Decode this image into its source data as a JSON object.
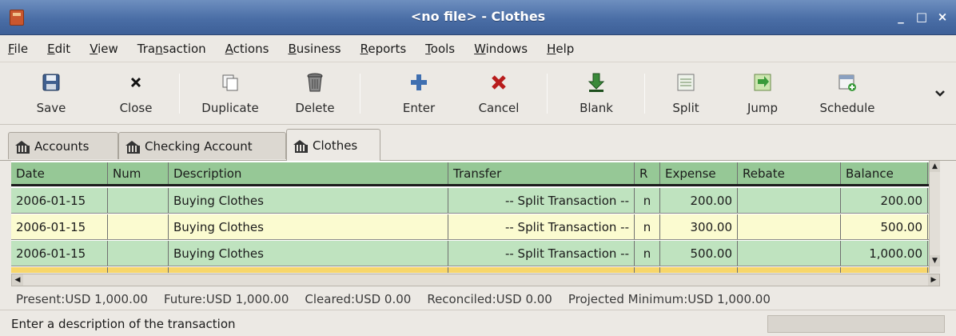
{
  "window": {
    "title": "<no file> - Clothes"
  },
  "menu": [
    "File",
    "Edit",
    "View",
    "Transaction",
    "Actions",
    "Business",
    "Reports",
    "Tools",
    "Windows",
    "Help"
  ],
  "menu_underline": [
    "F",
    "E",
    "V",
    "n",
    "A",
    "B",
    "R",
    "T",
    "W",
    "H"
  ],
  "toolbar": {
    "save": "Save",
    "close": "Close",
    "duplicate": "Duplicate",
    "delete": "Delete",
    "enter": "Enter",
    "cancel": "Cancel",
    "blank": "Blank",
    "split": "Split",
    "jump": "Jump",
    "schedule": "Schedule"
  },
  "tabs": [
    "Accounts",
    "Checking Account",
    "Clothes"
  ],
  "register": {
    "columns": [
      "Date",
      "Num",
      "Description",
      "Transfer",
      "R",
      "Expense",
      "Rebate",
      "Balance"
    ],
    "rows": [
      {
        "date": "2006-01-15",
        "num": "",
        "description": "Buying Clothes",
        "transfer": "-- Split Transaction --",
        "r": "n",
        "expense": "200.00",
        "rebate": "",
        "balance": "200.00"
      },
      {
        "date": "2006-01-15",
        "num": "",
        "description": "Buying Clothes",
        "transfer": "-- Split Transaction --",
        "r": "n",
        "expense": "300.00",
        "rebate": "",
        "balance": "500.00"
      },
      {
        "date": "2006-01-15",
        "num": "",
        "description": "Buying Clothes",
        "transfer": "-- Split Transaction --",
        "r": "n",
        "expense": "500.00",
        "rebate": "",
        "balance": "1,000.00"
      }
    ]
  },
  "summary": {
    "present": "Present:USD 1,000.00",
    "future": "Future:USD 1,000.00",
    "cleared": "Cleared:USD 0.00",
    "reconciled": "Reconciled:USD 0.00",
    "projected": "Projected Minimum:USD 1,000.00"
  },
  "status": {
    "message": "Enter a description of the transaction"
  }
}
